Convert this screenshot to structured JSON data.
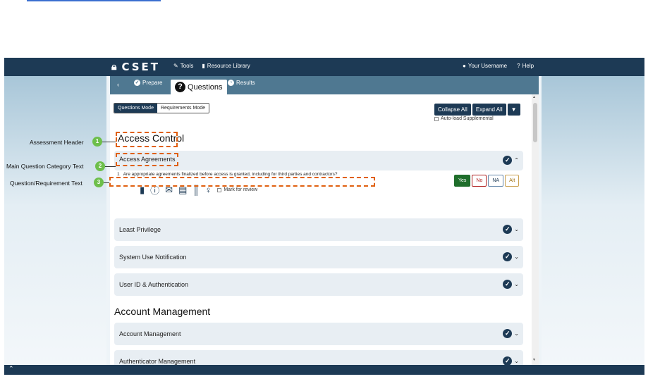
{
  "topbar": {
    "logo": "CSET",
    "tools": "Tools",
    "resource_library": "Resource Library",
    "username": "Your Username",
    "help": "Help"
  },
  "subnav": {
    "back": "‹",
    "prepare": "Prepare",
    "questions": "Questions",
    "results": "Results"
  },
  "modes": {
    "questions_mode": "Questions Mode",
    "requirements_mode": "Requirements Mode"
  },
  "actions": {
    "collapse_all": "Collapse All",
    "expand_all": "Expand All",
    "filter_icon": "filter-icon",
    "auto_load": "Auto-load Supplemental"
  },
  "sections": [
    {
      "header": "Access Control",
      "groups": [
        "Access Agreements",
        "Least Privilege",
        "System Use Notification",
        "User ID & Authentication"
      ]
    },
    {
      "header": "Account Management",
      "groups": [
        "Account Management",
        "Authenticator Management"
      ]
    }
  ],
  "question": {
    "number": "1",
    "text": "Are appropriate agreements finalized before access is granted, including for third parties and contractors?",
    "mark_for_review": "Mark for review",
    "answers": [
      "Yes",
      "No",
      "NA",
      "Alt"
    ],
    "selected": "Yes"
  },
  "callouts": [
    {
      "number": "1",
      "label": "Assessment Header"
    },
    {
      "number": "2",
      "label": "Main Question Category Text"
    },
    {
      "number": "3",
      "label": "Question/Requirement Text"
    }
  ],
  "colors": {
    "navbar": "#1d3a55",
    "subnav": "#4f7891",
    "callout_badge": "#6dbf4b",
    "highlight": "#e06010",
    "yes": "#1f6e2b"
  }
}
